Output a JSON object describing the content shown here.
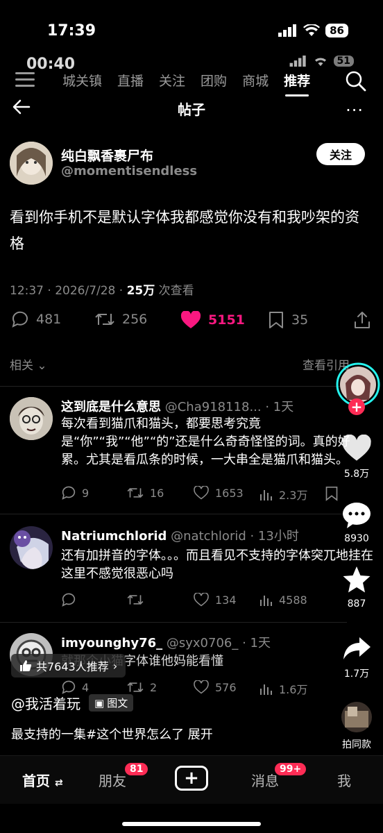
{
  "status_outer": {
    "time": "17:39",
    "battery": "86"
  },
  "status_inner": {
    "time": "00:40",
    "battery": "51"
  },
  "tabs": [
    "城关镇",
    "直播",
    "关注",
    "团购",
    "商城",
    "推荐"
  ],
  "post_header": {
    "title": "帖子",
    "more": "..."
  },
  "author": {
    "name": "纯白飘香裹尸布",
    "handle": "@momentisendless",
    "follow": "关注"
  },
  "post": {
    "text": "看到你手机不是默认字体我都感觉你没有和我吵架的资格",
    "time_date": "12:37 · 2026/7/28 · ",
    "views_count": "25万",
    "views_label": " 次查看",
    "replies": "481",
    "reposts": "256",
    "likes": "5151",
    "bookmarks": "35"
  },
  "related": {
    "label": "相关",
    "view_quotes": "查看引用"
  },
  "replies": [
    {
      "name": "这到底是什么意思",
      "handle": "@Cha918118... · 1天",
      "body": "每次看到猫爪和猫头，都要思考究竟是“你”“我”“他”“的”还是什么奇奇怪怪的词。真的好累。尤其是看瓜条的时候，一大串全是猫爪和猫头。",
      "replies": "9",
      "reposts": "16",
      "likes": "1653",
      "views": "2.3万"
    },
    {
      "name": "Natriumchlorid",
      "handle": "@natchlorid · 13小时",
      "body": "还有加拼音的字体。。。而且看见不支持的字体突兀地挂在这里不感觉很恶心吗",
      "replies": "",
      "reposts": "",
      "likes": "134",
      "views": "4588"
    },
    {
      "name": "imyounghy76_",
      "handle": "@syx0706_ · 1天",
      "body": "就那个小猫字体谁他妈能看懂",
      "replies": "4",
      "reposts": "2",
      "likes": "576",
      "views": "1.6万"
    }
  ],
  "rail": {
    "likes": "5.8万",
    "comments": "8930",
    "favorites": "887",
    "shares": "1.7万",
    "same_style": "拍同款"
  },
  "recommend": "共7643人推荐",
  "channel": {
    "name": "@我活着玩",
    "tag": "图文"
  },
  "caption": "最支持的一集#这个世界怎么了  展开",
  "bottom_nav": {
    "home": "首页",
    "friends": "朋友",
    "friends_badge": "81",
    "messages": "消息",
    "messages_badge": "99+",
    "me": "我"
  },
  "colors": {
    "like_pink": "#f91880",
    "douyin_red": "#fe2c55",
    "muted": "#8b8b8b"
  }
}
